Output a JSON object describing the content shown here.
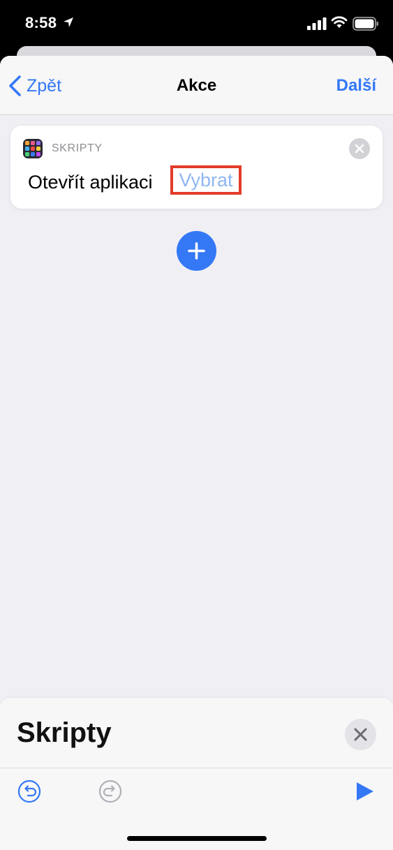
{
  "status_bar": {
    "time": "8:58",
    "icons": [
      "location-arrow-icon",
      "cellular-signal-icon",
      "wifi-icon",
      "battery-icon"
    ]
  },
  "navbar": {
    "back_label": "Zpět",
    "title": "Akce",
    "next_label": "Další"
  },
  "action_card": {
    "category": "SKRIPTY",
    "action_label": "Otevřít aplikaci",
    "parameter_placeholder": "Vybrat",
    "highlight_color": "#e23b2a"
  },
  "bottom_panel": {
    "title": "Skripty"
  },
  "colors": {
    "accent": "#3478f6",
    "background": "#efeff4",
    "placeholder": "#8fb6f3"
  }
}
